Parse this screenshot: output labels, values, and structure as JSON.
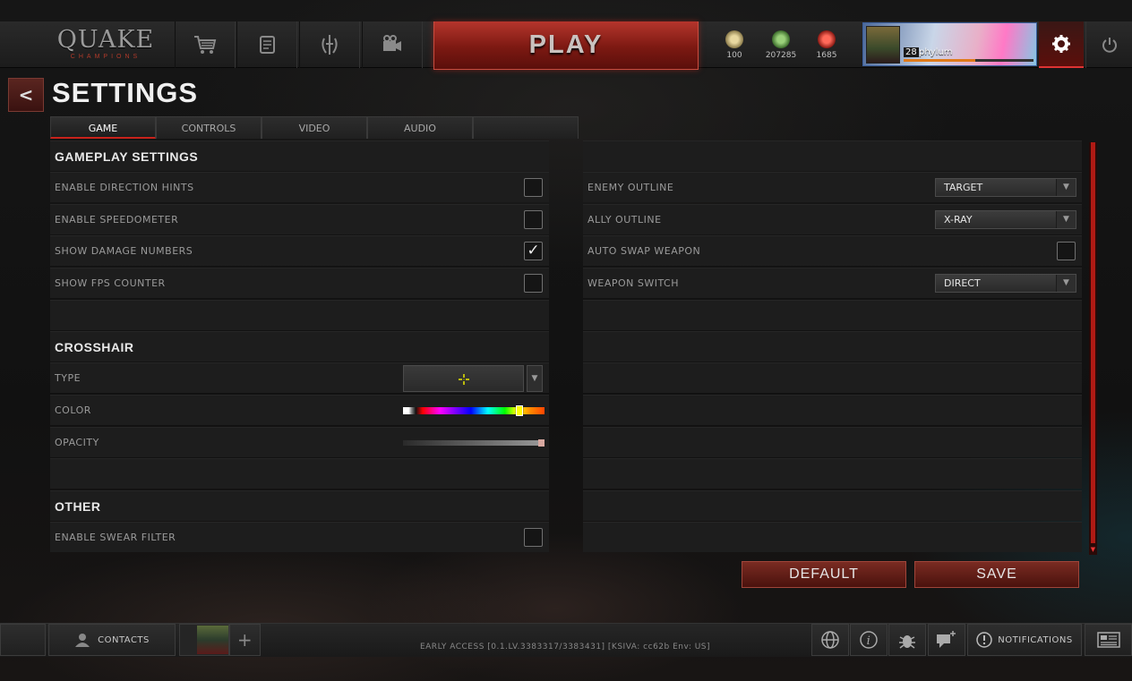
{
  "topbar": {
    "logo_main": "QUAKE",
    "logo_sub": "CHAMPIONS",
    "play_label": "PLAY",
    "currencies": [
      {
        "value": "100",
        "icon": "gold-medal-icon",
        "color": "#d8c38a"
      },
      {
        "value": "207285",
        "icon": "green-shard-icon",
        "color": "#5fae4a"
      },
      {
        "value": "1685",
        "icon": "red-crystal-icon",
        "color": "#d23a30"
      }
    ],
    "profile": {
      "level": "28",
      "name": "phylum",
      "xp_fraction": 0.55
    }
  },
  "header": {
    "title": "SETTINGS",
    "back_label": "<"
  },
  "tabs": [
    {
      "label": "GAME",
      "active": true
    },
    {
      "label": "CONTROLS",
      "active": false
    },
    {
      "label": "VIDEO",
      "active": false
    },
    {
      "label": "AUDIO",
      "active": false
    },
    {
      "label": "",
      "active": false
    }
  ],
  "gameplay": {
    "title": "GAMEPLAY SETTINGS",
    "items": [
      {
        "label": "ENABLE DIRECTION HINTS",
        "checked": false
      },
      {
        "label": "ENABLE SPEEDOMETER",
        "checked": false
      },
      {
        "label": "SHOW DAMAGE NUMBERS",
        "checked": true
      },
      {
        "label": "SHOW FPS COUNTER",
        "checked": false
      }
    ]
  },
  "crosshair": {
    "title": "CROSSHAIR",
    "type_label": "TYPE",
    "color_label": "COLOR",
    "opacity_label": "OPACITY",
    "color_position": 0.82,
    "opacity_fraction": 1.0,
    "crosshair_color": "#e8e800"
  },
  "other": {
    "title": "OTHER",
    "items": [
      {
        "label": "ENABLE SWEAR FILTER",
        "checked": false
      }
    ]
  },
  "right": {
    "items": [
      {
        "label": "ENEMY OUTLINE",
        "kind": "dropdown",
        "value": "TARGET"
      },
      {
        "label": "ALLY OUTLINE",
        "kind": "dropdown",
        "value": "X-RAY"
      },
      {
        "label": "AUTO SWAP WEAPON",
        "kind": "checkbox",
        "checked": false
      },
      {
        "label": "WEAPON SWITCH",
        "kind": "dropdown",
        "value": "DIRECT"
      }
    ]
  },
  "actions": {
    "default_label": "DEFAULT",
    "save_label": "SAVE"
  },
  "bottombar": {
    "contacts_label": "CONTACTS",
    "party_add": "+",
    "version": "EARLY ACCESS [0.1.LV.3383317/3383431] [KSIVA: cc62b Env: US]",
    "notifications_label": "NOTIFICATIONS"
  }
}
